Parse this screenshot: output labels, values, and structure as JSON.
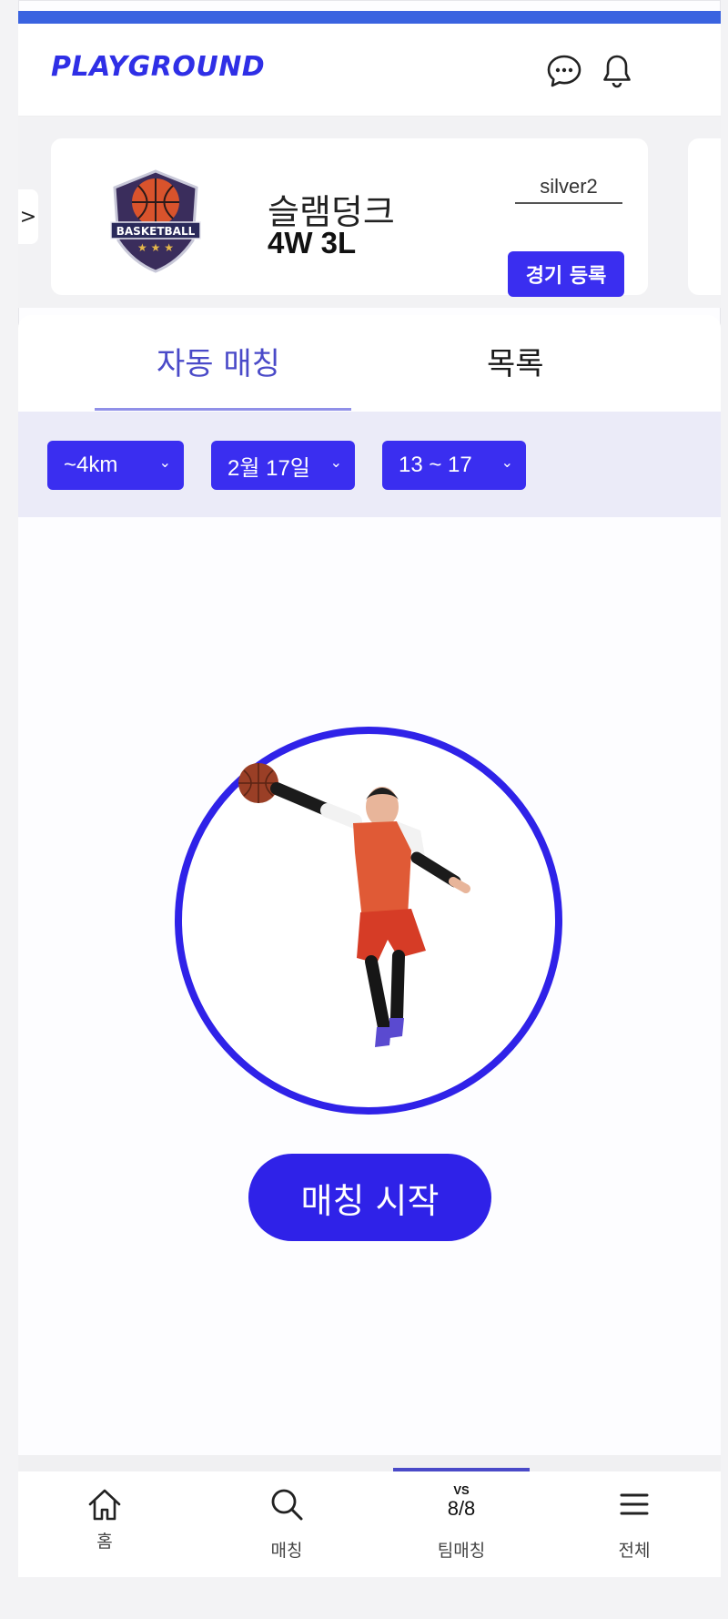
{
  "app": {
    "logo": "PLAYGROUND"
  },
  "header": {
    "chat_icon": "chat-bubble-icon",
    "bell_icon": "bell-icon"
  },
  "team": {
    "prev_arrow": ">",
    "name": "슬램덩크",
    "record": "4W 3L",
    "tier": "silver2",
    "register_label": "경기 등록",
    "badge_text": "BASKETBALL"
  },
  "tabs": [
    {
      "label": "자동 매칭",
      "active": true
    },
    {
      "label": "목록",
      "active": false
    }
  ],
  "filters": {
    "distance": "~4km",
    "date": "2월 17일",
    "time": "13 ~ 17"
  },
  "main": {
    "start_label": "매칭 시작"
  },
  "nav": [
    {
      "label": "홈",
      "icon": "home-icon"
    },
    {
      "label": "매칭",
      "icon": "search-icon"
    },
    {
      "label": "팀매칭",
      "icon": "vs-icon",
      "icon_text": "VS",
      "icon_sub": "8/8",
      "active": true
    },
    {
      "label": "전체",
      "icon": "menu-icon"
    }
  ],
  "colors": {
    "brand": "#2f22e8",
    "topbar": "#3a63e0",
    "filter_bg": "#ebebf8"
  }
}
